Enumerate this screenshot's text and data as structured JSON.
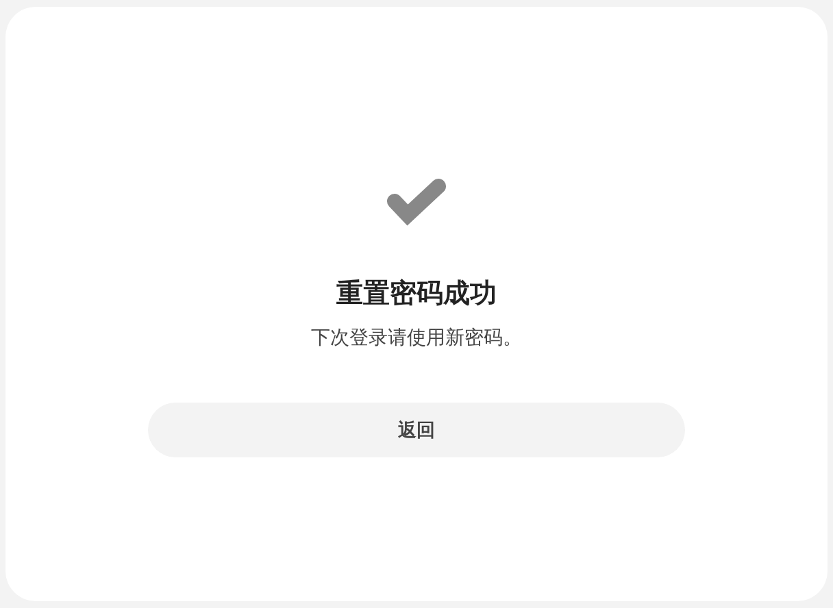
{
  "result": {
    "title": "重置密码成功",
    "message": "下次登录请使用新密码。"
  },
  "buttons": [
    {
      "label": "返回"
    }
  ]
}
